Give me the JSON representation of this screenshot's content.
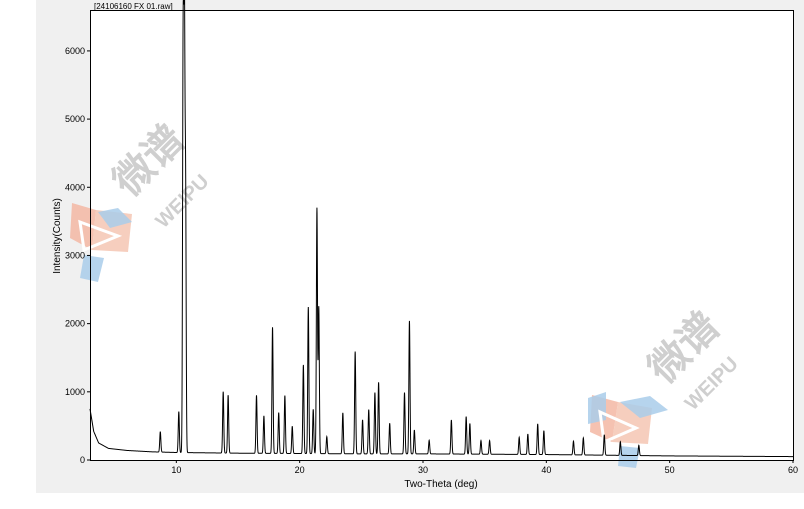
{
  "file_label": "[24106160 FX 01.raw]",
  "watermark": {
    "cn": "微谱",
    "en": "WEIPU"
  },
  "chart_data": {
    "type": "line",
    "title": "",
    "xlabel": "Two-Theta (deg)",
    "ylabel": "Intensity(Counts)",
    "xlim": [
      3,
      60
    ],
    "ylim": [
      0,
      6600
    ],
    "xticks": [
      10,
      20,
      30,
      40,
      50,
      60
    ],
    "yticks": [
      0,
      1000,
      2000,
      3000,
      4000,
      5000,
      6000
    ],
    "grid": false,
    "color": "#000000",
    "baseline": [
      [
        3.0,
        750
      ],
      [
        3.3,
        420
      ],
      [
        3.7,
        250
      ],
      [
        4.5,
        170
      ],
      [
        6.0,
        140
      ],
      [
        8.0,
        120
      ],
      [
        10.0,
        110
      ],
      [
        15.0,
        100
      ],
      [
        20.0,
        95
      ],
      [
        25.0,
        90
      ],
      [
        30.0,
        90
      ],
      [
        35.0,
        85
      ],
      [
        40.0,
        80
      ],
      [
        45.0,
        70
      ],
      [
        50.0,
        60
      ],
      [
        55.0,
        55
      ],
      [
        60.0,
        50
      ]
    ],
    "peaks": [
      [
        8.7,
        300
      ],
      [
        10.2,
        600
      ],
      [
        10.55,
        5900
      ],
      [
        10.65,
        6300
      ],
      [
        10.75,
        3800
      ],
      [
        13.8,
        900
      ],
      [
        14.2,
        850
      ],
      [
        16.5,
        850
      ],
      [
        17.1,
        550
      ],
      [
        17.8,
        1850
      ],
      [
        18.3,
        600
      ],
      [
        18.8,
        850
      ],
      [
        19.4,
        400
      ],
      [
        20.3,
        1300
      ],
      [
        20.7,
        2150
      ],
      [
        21.1,
        650
      ],
      [
        21.4,
        3600
      ],
      [
        21.55,
        2150
      ],
      [
        22.2,
        250
      ],
      [
        23.5,
        600
      ],
      [
        24.5,
        1500
      ],
      [
        25.1,
        500
      ],
      [
        25.6,
        650
      ],
      [
        26.1,
        900
      ],
      [
        26.4,
        1050
      ],
      [
        27.3,
        450
      ],
      [
        28.5,
        900
      ],
      [
        28.9,
        1950
      ],
      [
        29.3,
        350
      ],
      [
        30.5,
        200
      ],
      [
        32.3,
        500
      ],
      [
        33.5,
        550
      ],
      [
        33.8,
        450
      ],
      [
        34.7,
        200
      ],
      [
        35.4,
        200
      ],
      [
        37.8,
        250
      ],
      [
        38.5,
        300
      ],
      [
        39.3,
        450
      ],
      [
        39.8,
        350
      ],
      [
        42.2,
        200
      ],
      [
        43.0,
        250
      ],
      [
        44.7,
        300
      ],
      [
        46.0,
        200
      ],
      [
        47.5,
        150
      ]
    ]
  }
}
